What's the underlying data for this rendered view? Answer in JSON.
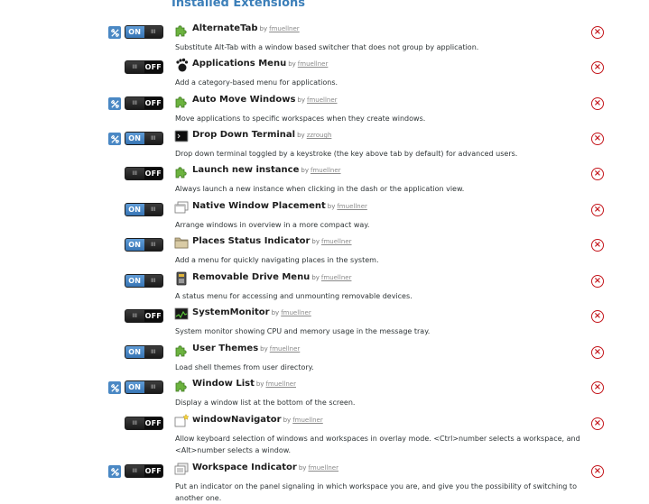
{
  "page": {
    "title": "Installed Extensions"
  },
  "colors": {
    "accent": "#3c7fb9",
    "switch_on": "#4a86c5",
    "remove": "#c4161c",
    "puzzle": "#6cb33f"
  },
  "extensions": [
    {
      "name": "AlternateTab",
      "by": "by",
      "author": "fmuellner",
      "description": "Substitute Alt-Tab with a window based switcher that does not group by application.",
      "enabled": true,
      "state_label": "ON",
      "has_prefs": true,
      "icon": "puzzle-icon"
    },
    {
      "name": "Applications Menu",
      "by": "by",
      "author": "fmuellner",
      "description": "Add a category-based menu for applications.",
      "enabled": false,
      "state_label": "OFF",
      "has_prefs": false,
      "icon": "gnome-foot-icon"
    },
    {
      "name": "Auto Move Windows",
      "by": "by",
      "author": "fmuellner",
      "description": "Move applications to specific workspaces when they create windows.",
      "enabled": false,
      "state_label": "OFF",
      "has_prefs": true,
      "icon": "puzzle-icon"
    },
    {
      "name": "Drop Down Terminal",
      "by": "by",
      "author": "zzrough",
      "description": "Drop down terminal toggled by a keystroke (the key above tab by default) for advanced users.",
      "enabled": true,
      "state_label": "ON",
      "has_prefs": true,
      "icon": "terminal-icon"
    },
    {
      "name": "Launch new instance",
      "by": "by",
      "author": "fmuellner",
      "description": "Always launch a new instance when clicking in the dash or the application view.",
      "enabled": false,
      "state_label": "OFF",
      "has_prefs": false,
      "icon": "puzzle-icon"
    },
    {
      "name": "Native Window Placement",
      "by": "by",
      "author": "fmuellner",
      "description": "Arrange windows in overview in a more compact way.",
      "enabled": true,
      "state_label": "ON",
      "has_prefs": false,
      "icon": "windows-icon"
    },
    {
      "name": "Places Status Indicator",
      "by": "by",
      "author": "fmuellner",
      "description": "Add a menu for quickly navigating places in the system.",
      "enabled": true,
      "state_label": "ON",
      "has_prefs": false,
      "icon": "folder-icon"
    },
    {
      "name": "Removable Drive Menu",
      "by": "by",
      "author": "fmuellner",
      "description": "A status menu for accessing and unmounting removable devices.",
      "enabled": true,
      "state_label": "ON",
      "has_prefs": false,
      "icon": "drive-icon"
    },
    {
      "name": "SystemMonitor",
      "by": "by",
      "author": "fmuellner",
      "description": "System monitor showing CPU and memory usage in the message tray.",
      "enabled": false,
      "state_label": "OFF",
      "has_prefs": false,
      "icon": "system-monitor-icon"
    },
    {
      "name": "User Themes",
      "by": "by",
      "author": "fmuellner",
      "description": "Load shell themes from user directory.",
      "enabled": true,
      "state_label": "ON",
      "has_prefs": false,
      "icon": "puzzle-icon"
    },
    {
      "name": "Window List",
      "by": "by",
      "author": "fmuellner",
      "description": "Display a window list at the bottom of the screen.",
      "enabled": true,
      "state_label": "ON",
      "has_prefs": true,
      "icon": "puzzle-icon"
    },
    {
      "name": "windowNavigator",
      "by": "by",
      "author": "fmuellner",
      "description": "Allow keyboard selection of windows and workspaces in overlay mode. <Ctrl>number selects a workspace, and <Alt>number selects a window.",
      "enabled": false,
      "state_label": "OFF",
      "has_prefs": false,
      "icon": "window-star-icon"
    },
    {
      "name": "Workspace Indicator",
      "by": "by",
      "author": "fmuellner",
      "description": "Put an indicator on the panel signaling in which workspace you are, and give you the possibility of switching to another one.",
      "enabled": false,
      "state_label": "OFF",
      "has_prefs": true,
      "icon": "workspace-icon"
    }
  ]
}
